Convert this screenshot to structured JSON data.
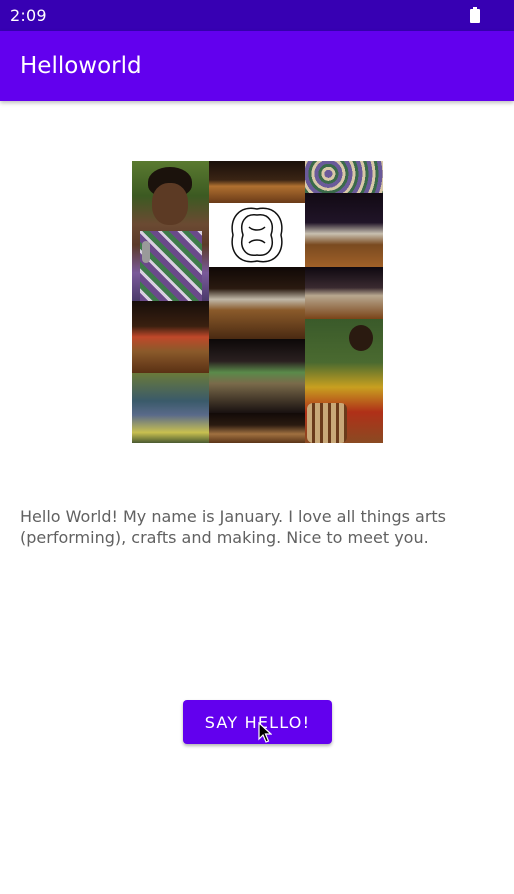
{
  "status_bar": {
    "time": "2:09",
    "battery_icon": "battery-full-icon"
  },
  "app_bar": {
    "title": "Helloworld"
  },
  "main": {
    "intro_text": "Hello World! My name is January. I love all things arts (performing), crafts and making. Nice to meet you.",
    "button_label": "SAY HELLO!"
  },
  "colors": {
    "status_bar": "#3700b3",
    "app_bar": "#6200ee",
    "button": "#6200ee",
    "body_text": "#616161"
  },
  "icons": {
    "cursor": "mouse-pointer-icon"
  }
}
